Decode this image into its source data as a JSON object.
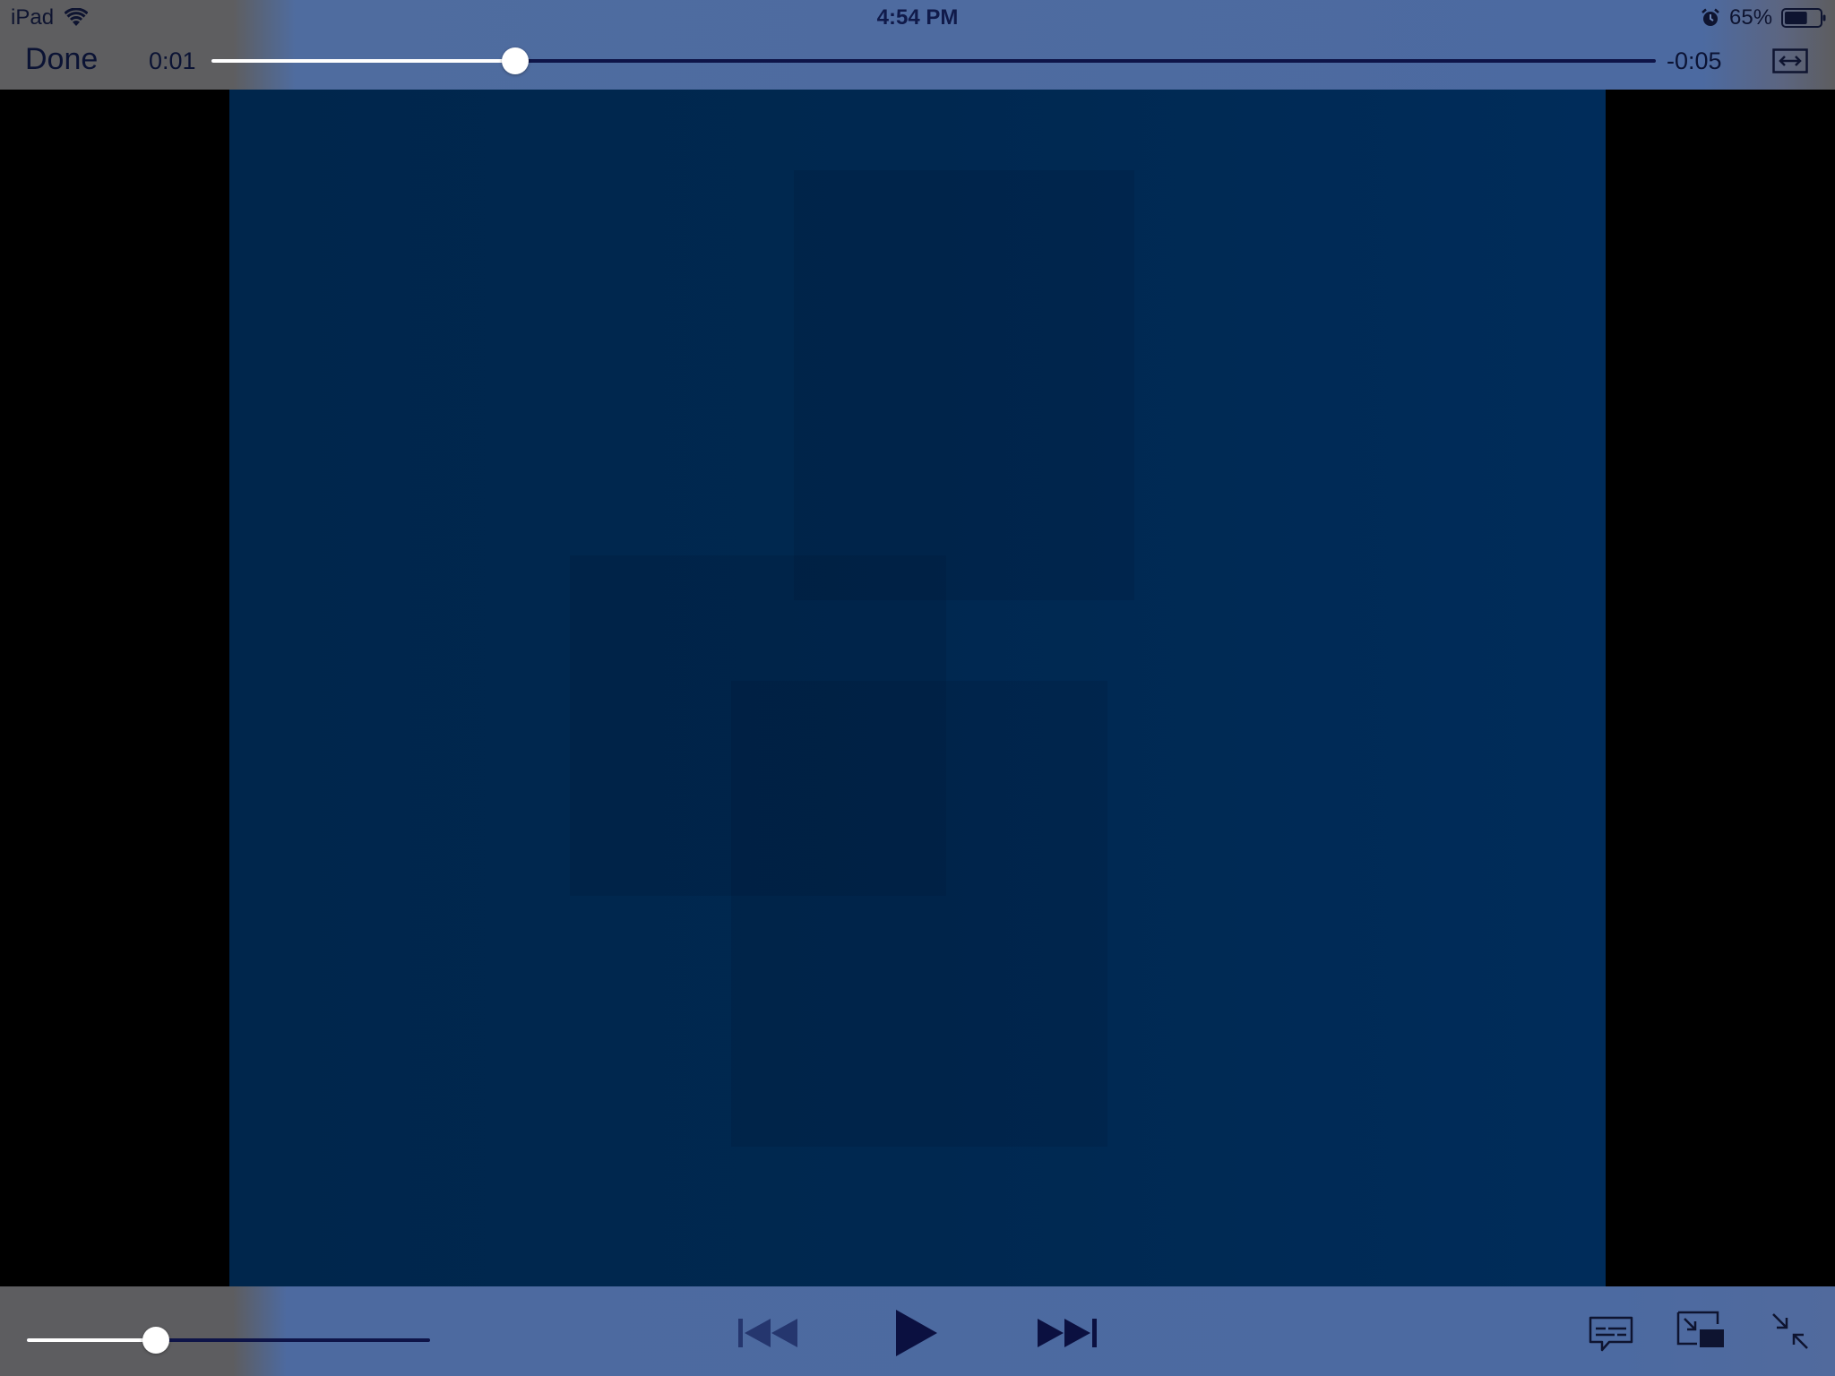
{
  "status_bar": {
    "device": "iPad",
    "time": "4:54 PM",
    "battery_percent": "65%",
    "battery_level": 0.65
  },
  "player": {
    "done_label": "Done",
    "elapsed": "0:01",
    "remaining": "-0:05",
    "progress_fraction": 0.21,
    "volume_fraction": 0.32
  },
  "icons": {
    "wifi": "wifi-icon",
    "alarm": "alarm-icon",
    "battery": "battery-icon",
    "aspect": "aspect-ratio-icon",
    "previous": "skip-back-icon",
    "play": "play-icon",
    "next": "skip-forward-icon",
    "subtitles": "subtitles-icon",
    "pip": "picture-in-picture-icon",
    "exit_fullscreen": "exit-fullscreen-icon"
  },
  "colors": {
    "bar_blue": "#4c6aa1",
    "control_dark": "#0e1448",
    "video_blue": "#002850"
  }
}
